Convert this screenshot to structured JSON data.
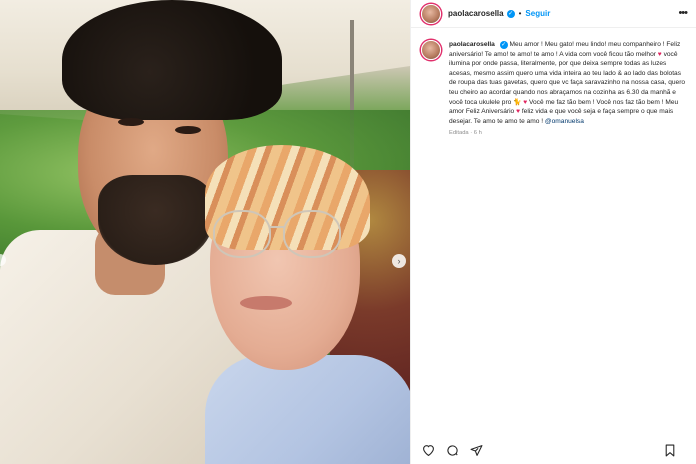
{
  "post": {
    "username": "paolacarosella",
    "follow_label": "Seguir",
    "separator": "•",
    "more_label": "•••",
    "caption": {
      "username": "paolacarosella",
      "part1": "Meu amor ! Meu gato! meu lindo! meu companheiro ! Feliz aniversário! Te amo! te amo! te amo ! A vida com você ficou tão melhor",
      "heart1": "♥",
      "part2": "você ilumina por onde passa, literalmente, por que deixa sempre todas as luzes acesas, mesmo assim quero uma vida inteira ao teu lado & ao lado das bolotas de roupa das tuas gavetas, quero que vc faça saravazinho na nossa casa, quero teu cheiro ao acordar quando nos abraçamos na cozinha as 6.30 da manhã e você toca ukulele pro",
      "emoji": "🐈",
      "heart2": "♥",
      "part3": "Você me faz tão bem ! Você nos faz tão bem ! Meu amor Feliz Aniversário",
      "heart3": "♥",
      "part4": "feliz vida e que você seja e faça sempre o que mais desejar. Te amo te amo te amo !",
      "mention": "@omanuelsa"
    },
    "meta": "Editada · 6 h"
  },
  "carousel": {
    "next_label": "›"
  },
  "actions": {
    "like": "heart-icon",
    "comment": "comment-icon",
    "share": "share-icon",
    "save": "bookmark-icon"
  },
  "colors": {
    "verified": "#0095f6",
    "follow": "#0095f6",
    "heart": "#e0245e",
    "mention": "#00376b"
  }
}
